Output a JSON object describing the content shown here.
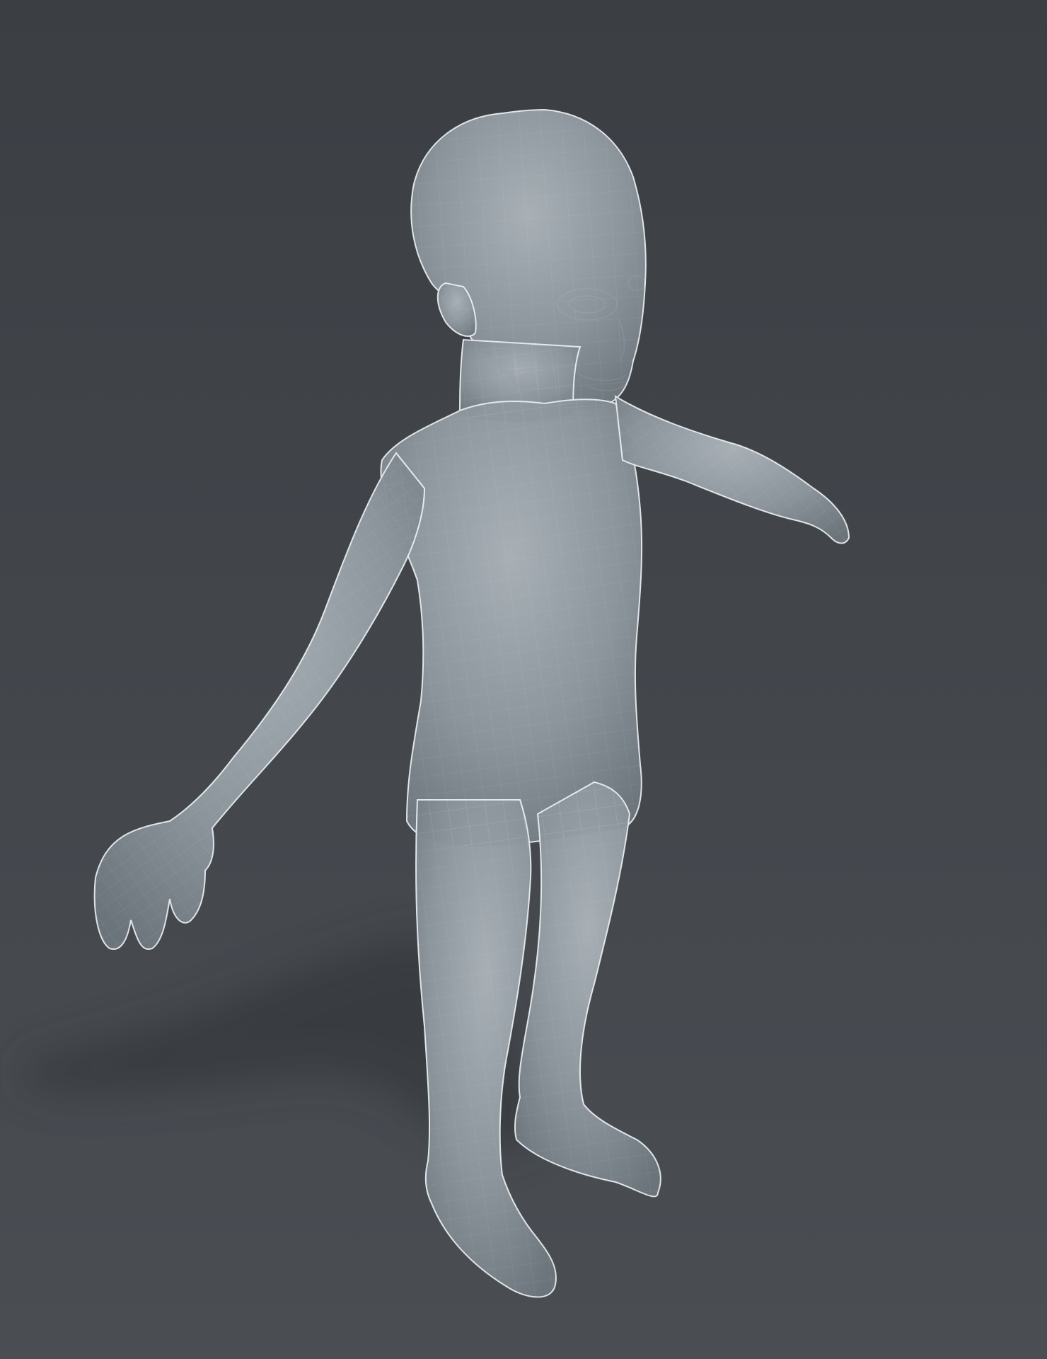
{
  "scene": {
    "subject": "wireframe-child-figure",
    "colors": {
      "background_top": "#3b3f44",
      "background_bottom": "#4a4e53",
      "shadow": "#2f3236",
      "body_light": "#a8b0b6",
      "body_mid": "#8c959c",
      "body_dark": "#6c747b",
      "wire": "#eef2f4"
    }
  }
}
